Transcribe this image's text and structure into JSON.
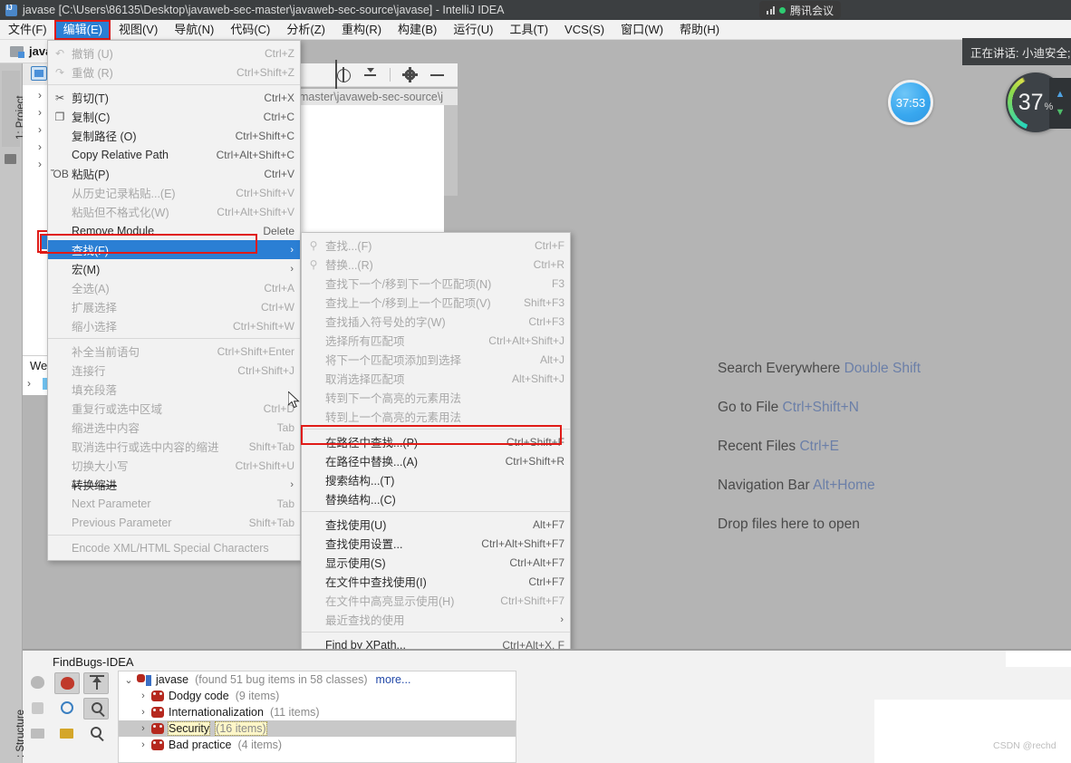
{
  "window": {
    "title": "javase [C:\\Users\\86135\\Desktop\\javaweb-sec-master\\javaweb-sec-source\\javase] - IntelliJ IDEA",
    "icon": "intellij-idea-icon"
  },
  "tencent_meeting": {
    "pill_label": "腾讯会议",
    "speaking_label": "正在讲话: 小迪安全;",
    "timer": "37:53",
    "network_value": "37",
    "network_unit": "%",
    "signal_icon": "signal-bars-icon",
    "status_dot_color": "#2ecc71"
  },
  "menubar": {
    "items": [
      {
        "label": "文件(F)",
        "active": false
      },
      {
        "label": "编辑(E)",
        "active": true
      },
      {
        "label": "视图(V)",
        "active": false
      },
      {
        "label": "导航(N)",
        "active": false
      },
      {
        "label": "代码(C)",
        "active": false
      },
      {
        "label": "分析(Z)",
        "active": false
      },
      {
        "label": "重构(R)",
        "active": false
      },
      {
        "label": "构建(B)",
        "active": false
      },
      {
        "label": "运行(U)",
        "active": false
      },
      {
        "label": "工具(T)",
        "active": false
      },
      {
        "label": "VCS(S)",
        "active": false
      },
      {
        "label": "窗口(W)",
        "active": false
      },
      {
        "label": "帮助(H)",
        "active": false
      }
    ]
  },
  "project_panel": {
    "tab_label": "1: Project",
    "header_title": "java",
    "welcome_label": "Wel",
    "path_fragment": "master\\javaweb-sec-source\\j",
    "toolbar_icons": [
      "locate-target-icon",
      "collapse-all-icon",
      "settings-gear-icon",
      "minimize-icon"
    ]
  },
  "edit_menu": {
    "items": [
      {
        "label": "撤销 (U)",
        "accel": "Ctrl+Z",
        "icon": "undo-icon",
        "disabled": true
      },
      {
        "label": "重做 (R)",
        "accel": "Ctrl+Shift+Z",
        "icon": "redo-icon",
        "disabled": true
      },
      {
        "sep": true
      },
      {
        "label": "剪切(T)",
        "accel": "Ctrl+X",
        "icon": "cut-icon"
      },
      {
        "label": "复制(C)",
        "accel": "Ctrl+C",
        "icon": "copy-icon"
      },
      {
        "label": "复制路径 (O)",
        "accel": "Ctrl+Shift+C",
        "icon": ""
      },
      {
        "label": "Copy Relative Path",
        "accel": "Ctrl+Alt+Shift+C",
        "icon": ""
      },
      {
        "label": "粘贴(P)",
        "accel": "Ctrl+V",
        "icon": "paste-icon"
      },
      {
        "label": "从历史记录粘贴...(E)",
        "accel": "Ctrl+Shift+V",
        "icon": "",
        "disabled": true
      },
      {
        "label": "粘贴但不格式化(W)",
        "accel": "Ctrl+Alt+Shift+V",
        "icon": "",
        "disabled": true
      },
      {
        "label": "Remove Module",
        "accel": "Delete",
        "icon": ""
      },
      {
        "label": "查找(F)",
        "accel": "",
        "icon": "",
        "arrow": "›",
        "selected": true,
        "highlight": true
      },
      {
        "label": "宏(M)",
        "accel": "",
        "icon": "",
        "arrow": "›"
      },
      {
        "label": "全选(A)",
        "accel": "Ctrl+A",
        "icon": "",
        "disabled": true
      },
      {
        "label": "扩展选择",
        "accel": "Ctrl+W",
        "icon": "",
        "disabled": true
      },
      {
        "label": "缩小选择",
        "accel": "Ctrl+Shift+W",
        "icon": "",
        "disabled": true
      },
      {
        "sep": true
      },
      {
        "label": "补全当前语句",
        "accel": "Ctrl+Shift+Enter",
        "icon": "",
        "disabled": true
      },
      {
        "label": "连接行",
        "accel": "Ctrl+Shift+J",
        "icon": "",
        "disabled": true
      },
      {
        "label": "填充段落",
        "accel": "",
        "icon": "",
        "disabled": true
      },
      {
        "label": "重复行或选中区域",
        "accel": "Ctrl+D",
        "icon": "",
        "disabled": true
      },
      {
        "label": "缩进选中内容",
        "accel": "Tab",
        "icon": "",
        "disabled": true
      },
      {
        "label": "取消选中行或选中内容的缩进",
        "accel": "Shift+Tab",
        "icon": "",
        "disabled": true
      },
      {
        "label": "切换大小写",
        "accel": "Ctrl+Shift+U",
        "icon": "",
        "disabled": true
      },
      {
        "label": "转换缩进",
        "accel": "",
        "icon": "",
        "arrow": "›",
        "strike": true
      },
      {
        "label": "Next Parameter",
        "accel": "Tab",
        "icon": "",
        "disabled": true
      },
      {
        "label": "Previous Parameter",
        "accel": "Shift+Tab",
        "icon": "",
        "disabled": true
      },
      {
        "sep": true
      },
      {
        "label": "Encode XML/HTML Special Characters",
        "accel": "",
        "icon": "",
        "disabled": true
      }
    ]
  },
  "find_submenu": {
    "items": [
      {
        "label": "查找...(F)",
        "accel": "Ctrl+F",
        "icon": "search-icon",
        "disabled": true
      },
      {
        "label": "替换...(R)",
        "accel": "Ctrl+R",
        "icon": "replace-icon",
        "disabled": true
      },
      {
        "label": "查找下一个/移到下一个匹配项(N)",
        "accel": "F3",
        "icon": "",
        "disabled": true
      },
      {
        "label": "查找上一个/移到上一个匹配项(V)",
        "accel": "Shift+F3",
        "icon": "",
        "disabled": true
      },
      {
        "label": "查找插入符号处的字(W)",
        "accel": "Ctrl+F3",
        "icon": "",
        "disabled": true
      },
      {
        "label": "选择所有匹配项",
        "accel": "Ctrl+Alt+Shift+J",
        "icon": "",
        "disabled": true
      },
      {
        "label": "将下一个匹配项添加到选择",
        "accel": "Alt+J",
        "icon": "",
        "disabled": true
      },
      {
        "label": "取消选择匹配项",
        "accel": "Alt+Shift+J",
        "icon": "",
        "disabled": true
      },
      {
        "label": "转到下一个高亮的元素用法",
        "accel": "",
        "icon": "",
        "disabled": true
      },
      {
        "label": "转到上一个高亮的元素用法",
        "accel": "",
        "icon": "",
        "disabled": true
      },
      {
        "sep": true
      },
      {
        "label": "在路径中查找...(P)",
        "accel": "Ctrl+Shift+F",
        "icon": "",
        "highlight": true
      },
      {
        "label": "在路径中替换...(A)",
        "accel": "Ctrl+Shift+R",
        "icon": ""
      },
      {
        "label": "搜索结构...(T)",
        "accel": "",
        "icon": ""
      },
      {
        "label": "替换结构...(C)",
        "accel": "",
        "icon": ""
      },
      {
        "sep": true
      },
      {
        "label": "查找使用(U)",
        "accel": "Alt+F7",
        "icon": ""
      },
      {
        "label": "查找使用设置...",
        "accel": "Ctrl+Alt+Shift+F7",
        "icon": ""
      },
      {
        "label": "显示使用(S)",
        "accel": "Ctrl+Alt+F7",
        "icon": ""
      },
      {
        "label": "在文件中查找使用(I)",
        "accel": "Ctrl+F7",
        "icon": ""
      },
      {
        "label": "在文件中高亮显示使用(H)",
        "accel": "Ctrl+Shift+F7",
        "icon": "",
        "disabled": true
      },
      {
        "label": "最近查找的使用",
        "accel": "",
        "icon": "",
        "arrow": "›",
        "disabled": true
      },
      {
        "sep": true
      },
      {
        "label": "Find by XPath...",
        "accel": "Ctrl+Alt+X, F",
        "icon": ""
      }
    ]
  },
  "welcome_hints": [
    {
      "text": "Search Everywhere ",
      "key": "Double Shift"
    },
    {
      "text": "Go to File ",
      "key": "Ctrl+Shift+N"
    },
    {
      "text": "Recent Files ",
      "key": "Ctrl+E"
    },
    {
      "text": "Navigation Bar ",
      "key": "Alt+Home"
    },
    {
      "text": "Drop files here to open",
      "key": ""
    }
  ],
  "findbugs": {
    "panel_title": "FindBugs-IDEA",
    "structure_tab_label": ": Structure",
    "toolbar_icons": [
      "bug-gray-icon",
      "bug-red-icon",
      "export-up-icon",
      "cube-gray-icon",
      "circle-c-icon",
      "find-bug-icon",
      "folder-gray-icon",
      "folder-bug-icon",
      "search-icon"
    ],
    "tree": {
      "root": {
        "name": "javase",
        "summary": "(found 51 bug items in 58 classes)",
        "more_link": "more...",
        "expanded": true
      },
      "children": [
        {
          "name": "Dodgy code",
          "count": "(9 items)",
          "selected": false
        },
        {
          "name": "Internationalization",
          "count": "(11 items)",
          "selected": false
        },
        {
          "name": "Security",
          "count": "(16 items)",
          "selected": true
        },
        {
          "name": "Bad practice",
          "count": "(4 items)",
          "selected": false
        }
      ]
    }
  },
  "watermark": "CSDN @rechd",
  "colors": {
    "accent_blue": "#2b7fd4",
    "highlight_red": "#e01b17",
    "desktop_gray": "#b4b4b4",
    "menu_bg": "#f2f2f2",
    "hint_key": "#6b7fa8"
  }
}
